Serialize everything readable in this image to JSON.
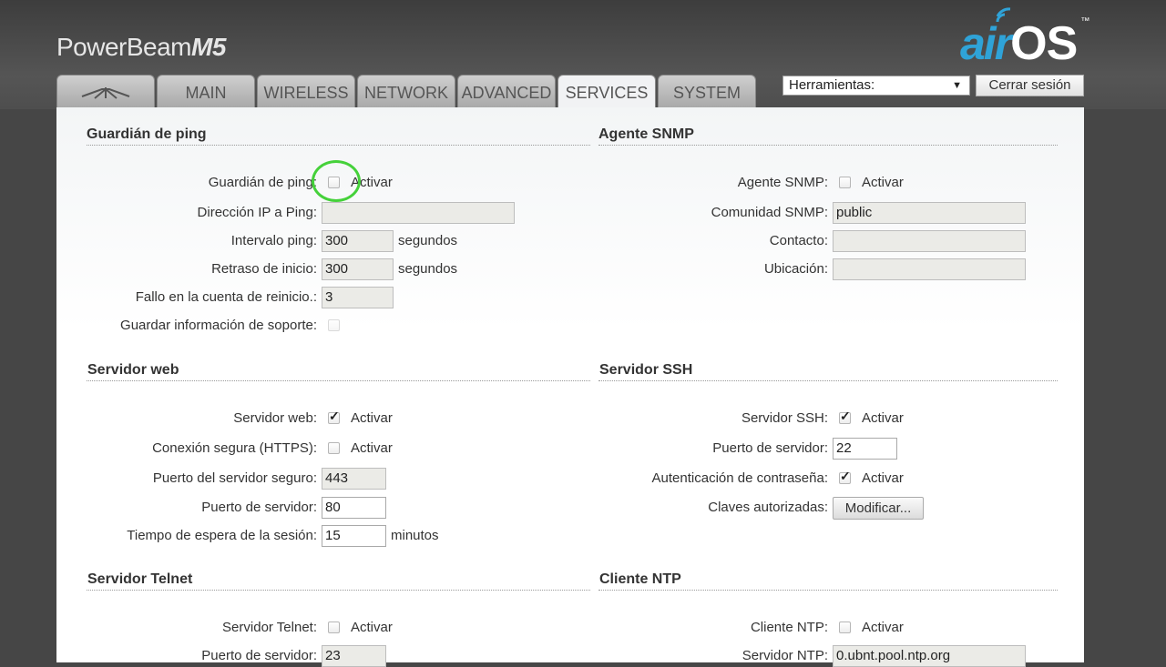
{
  "header": {
    "product_name": "PowerBeam",
    "product_model": "M5",
    "brand_logo_air": "air",
    "brand_logo_os": "OS",
    "brand_logo_tm": "™",
    "tools_select_value": "Herramientas:",
    "logout_label": "Cerrar sesión"
  },
  "tabs": [
    {
      "label": "",
      "icon": "ubiquiti-logo-icon"
    },
    {
      "label": "MAIN"
    },
    {
      "label": "WIRELESS"
    },
    {
      "label": "NETWORK"
    },
    {
      "label": "ADVANCED"
    },
    {
      "label": "SERVICES",
      "active": true
    },
    {
      "label": "SYSTEM"
    }
  ],
  "ping_watchdog": {
    "title": "Guardián de ping",
    "enable_label": "Guardián de ping:",
    "enable_text": "Activar",
    "enabled": false,
    "ip_label": "Dirección IP a Ping:",
    "ip_value": "",
    "interval_label": "Intervalo ping:",
    "interval_value": "300",
    "interval_unit": "segundos",
    "delay_label": "Retraso de inicio:",
    "delay_value": "300",
    "delay_unit": "segundos",
    "failure_label": "Fallo en la cuenta de reinicio.:",
    "failure_value": "3",
    "support_label": "Guardar información de soporte:",
    "support_checked": false
  },
  "snmp": {
    "title": "Agente SNMP",
    "enable_label": "Agente SNMP:",
    "enable_text": "Activar",
    "enabled": false,
    "community_label": "Comunidad SNMP:",
    "community_value": "public",
    "contact_label": "Contacto:",
    "contact_value": "",
    "location_label": "Ubicación:",
    "location_value": ""
  },
  "web_server": {
    "title": "Servidor web",
    "enable_label": "Servidor web:",
    "enable_text": "Activar",
    "enabled": true,
    "https_label": "Conexión segura (HTTPS):",
    "https_text": "Activar",
    "https_enabled": false,
    "secure_port_label": "Puerto del servidor seguro:",
    "secure_port_value": "443",
    "port_label": "Puerto de servidor:",
    "port_value": "80",
    "timeout_label": "Tiempo de espera de la sesión:",
    "timeout_value": "15",
    "timeout_unit": "minutos"
  },
  "ssh": {
    "title": "Servidor SSH",
    "enable_label": "Servidor SSH:",
    "enable_text": "Activar",
    "enabled": true,
    "port_label": "Puerto de servidor:",
    "port_value": "22",
    "password_auth_label": "Autenticación de contraseña:",
    "password_auth_text": "Activar",
    "password_auth_enabled": true,
    "keys_label": "Claves autorizadas:",
    "keys_button": "Modificar..."
  },
  "telnet": {
    "title": "Servidor Telnet",
    "enable_label": "Servidor Telnet:",
    "enable_text": "Activar",
    "enabled": false,
    "port_label": "Puerto de servidor:",
    "port_value": "23"
  },
  "ntp": {
    "title": "Cliente NTP",
    "enable_label": "Cliente NTP:",
    "enable_text": "Activar",
    "enabled": false,
    "server_label": "Servidor NTP:",
    "server_value": "0.ubnt.pool.ntp.org"
  },
  "colors": {
    "accent_blue": "#2fa3d8",
    "highlight_green": "#45d13a"
  }
}
